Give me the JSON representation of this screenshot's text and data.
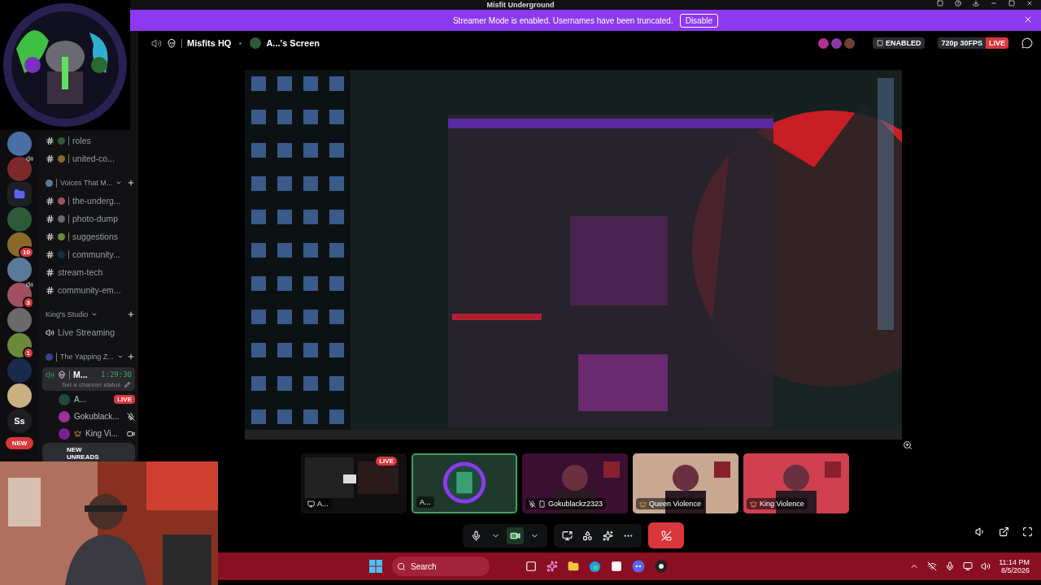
{
  "window": {
    "title": "Misfit Underground"
  },
  "banner": {
    "text": "Streamer Mode is enabled. Usernames have been truncated.",
    "button": "Disable"
  },
  "servers": [
    {
      "kind": "server",
      "voice": false
    },
    {
      "kind": "server",
      "voice": true
    },
    {
      "kind": "folder",
      "voice": false
    },
    {
      "kind": "server",
      "voice": false
    },
    {
      "kind": "server",
      "voice": false,
      "badge": "10"
    },
    {
      "kind": "server",
      "voice": false
    },
    {
      "kind": "server",
      "voice": true,
      "badge": "3"
    },
    {
      "kind": "server",
      "voice": false
    },
    {
      "kind": "server",
      "voice": false,
      "badge": "1"
    },
    {
      "kind": "server",
      "voice": false
    },
    {
      "kind": "server",
      "voice": false
    },
    {
      "kind": "text",
      "voice": false,
      "label": "Ss"
    }
  ],
  "new_pill": "NEW",
  "channels": [
    {
      "kind": "text",
      "name": "roles",
      "emoji": true
    },
    {
      "kind": "text",
      "name": "united-co...",
      "emoji": true
    },
    {
      "kind": "category",
      "name": "Voices That M...",
      "emoji": true
    },
    {
      "kind": "text",
      "name": "the-underg...",
      "emoji": true
    },
    {
      "kind": "text",
      "name": "photo-dump",
      "emoji": true
    },
    {
      "kind": "text",
      "name": "suggestions",
      "emoji": true
    },
    {
      "kind": "text",
      "name": "community...",
      "emoji": true
    },
    {
      "kind": "text",
      "name": "stream-tech",
      "emoji": false
    },
    {
      "kind": "text",
      "name": "community-em...",
      "emoji": false
    },
    {
      "kind": "category",
      "name": "King's Studio",
      "emoji": false
    },
    {
      "kind": "voice",
      "name": "Live Streaming",
      "emoji": false
    },
    {
      "kind": "category",
      "name": "The Yapping Z...",
      "emoji": true
    },
    {
      "kind": "active_voice",
      "name": "M...",
      "emoji": true,
      "timer": "1:29:30",
      "status": "Set a channel status",
      "children": [
        {
          "kind": "streaming",
          "name": "A...",
          "live": "LIVE",
          "crown": false
        },
        {
          "kind": "muted",
          "name": "Gokublack...",
          "crown": false
        },
        {
          "kind": "video",
          "name": "King Vi...",
          "crown": true
        }
      ]
    }
  ],
  "new_unreads": "NEW UNREADS",
  "header": {
    "channel": "Misfits HQ",
    "stream": "A...'s Screen",
    "mode": "ENABLED",
    "quality": "720p 30FPS",
    "live": "LIVE"
  },
  "tiles": [
    {
      "kind": "screen",
      "name": "A...",
      "live": "LIVE",
      "selected": false,
      "muted": false,
      "crown": false
    },
    {
      "kind": "avatar",
      "name": "A...",
      "selected": true,
      "muted": false,
      "crown": false
    },
    {
      "kind": "video",
      "name": "Gokublackz2323",
      "selected": false,
      "muted": true,
      "crown": false
    },
    {
      "kind": "video",
      "name": "Queen Violence",
      "selected": false,
      "muted": false,
      "crown": true
    },
    {
      "kind": "video",
      "name": "King Violence",
      "selected": false,
      "muted": false,
      "crown": true
    }
  ],
  "controls": {
    "camera_on": true
  },
  "taskbar": {
    "search": "Search",
    "time": "11:14 PM",
    "date": "8/5/2026"
  }
}
